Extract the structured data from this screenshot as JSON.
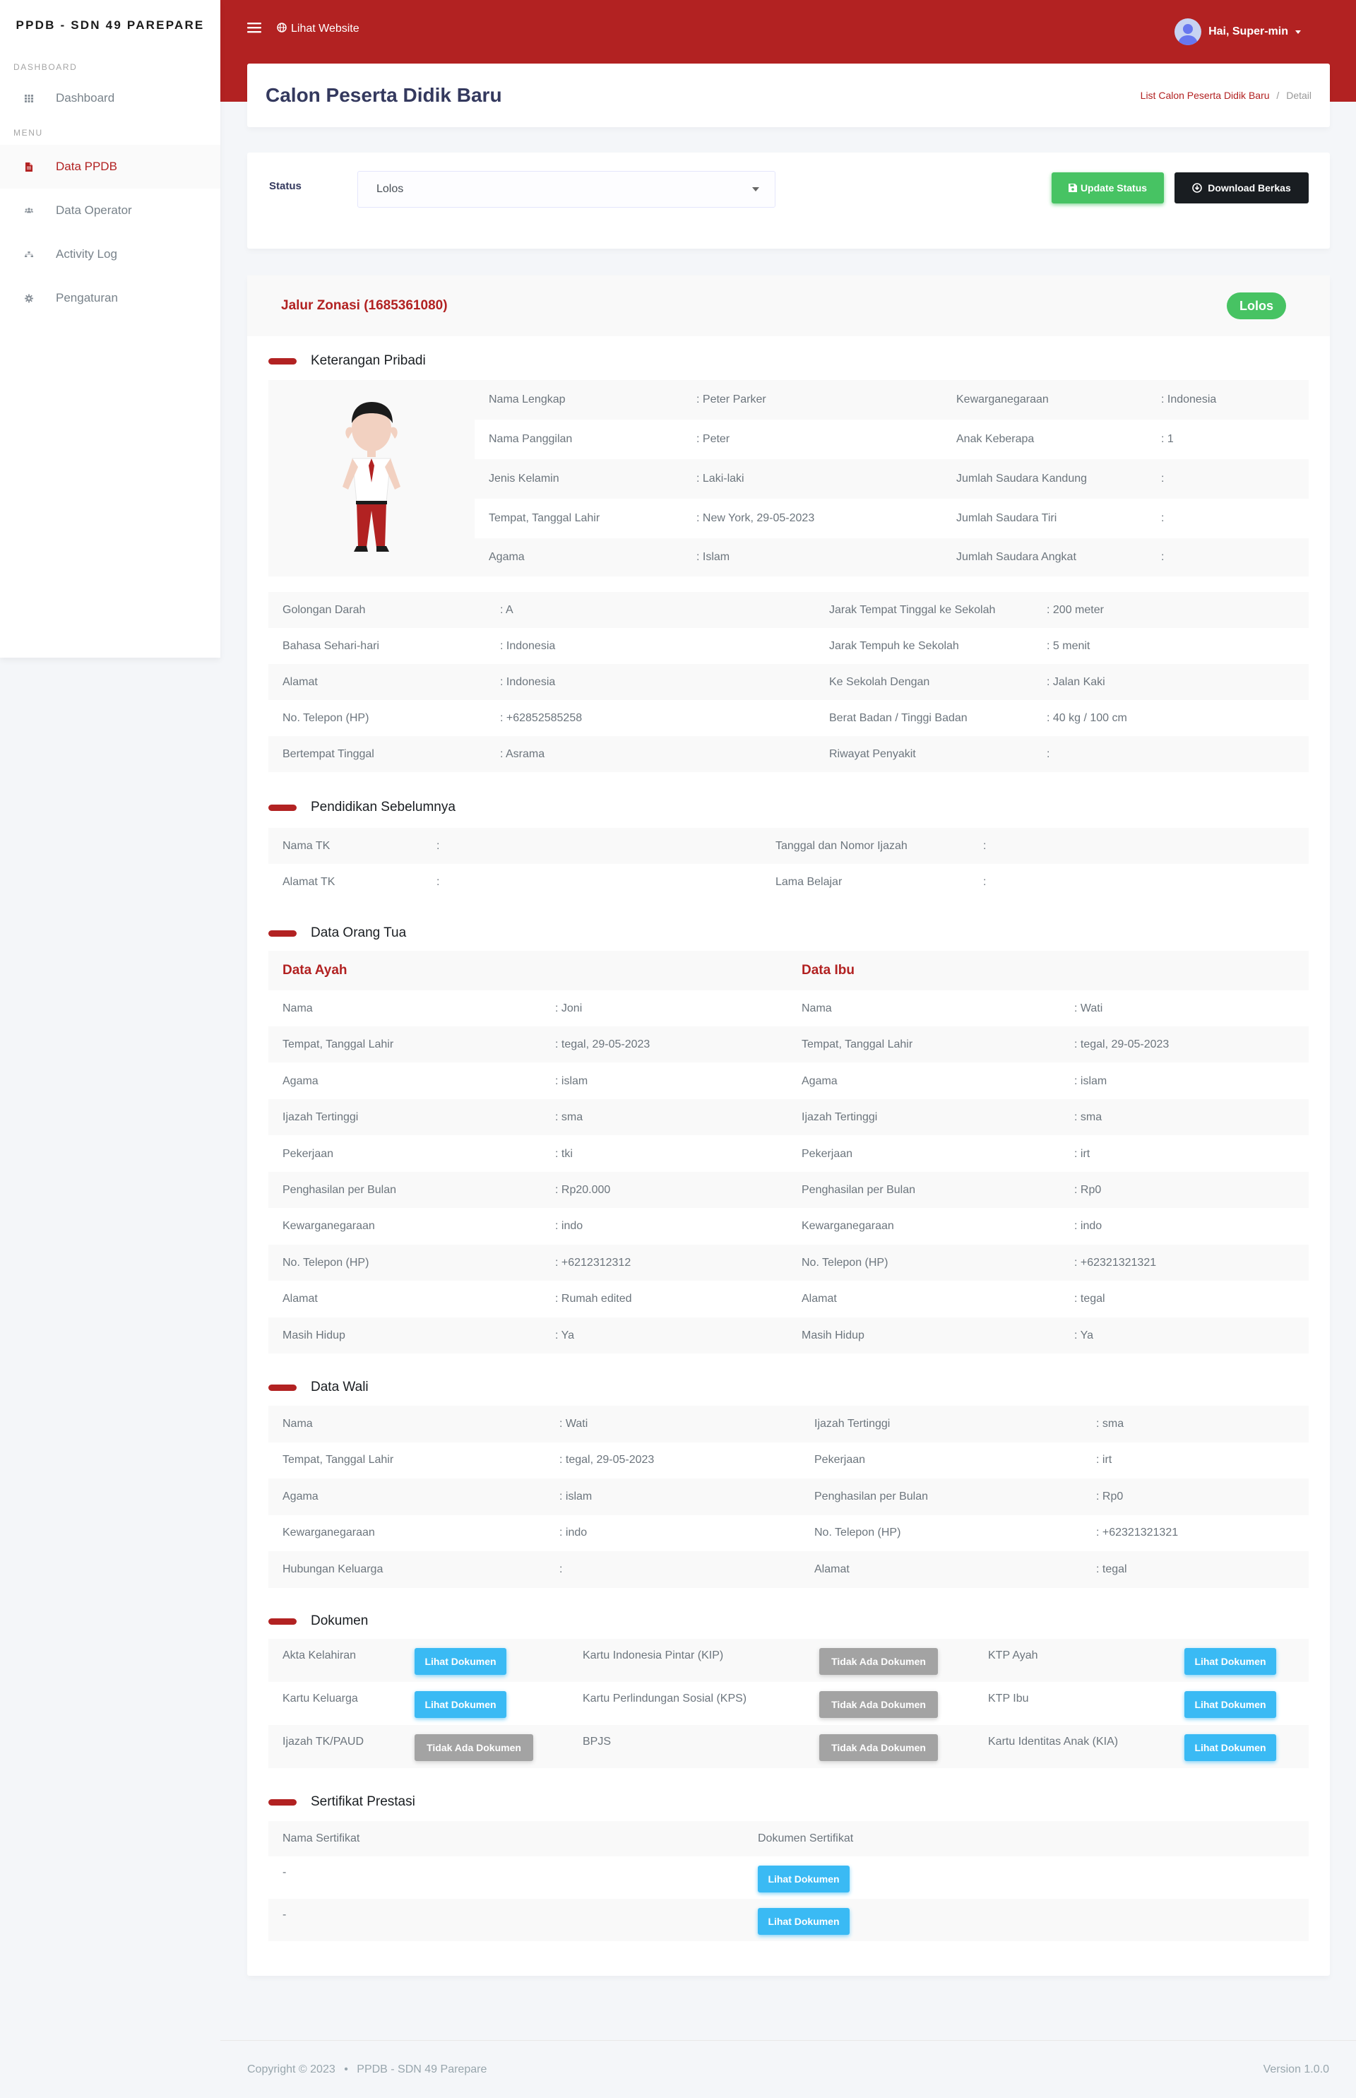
{
  "app": {
    "brand": "PPDB - SDN 49 PAREPARE"
  },
  "sidebar": {
    "header_dashboard": "DASHBOARD",
    "header_menu": "MENU",
    "items": [
      {
        "label": "Dashboard",
        "icon": "grid-icon"
      },
      {
        "label": "Data PPDB",
        "icon": "file-icon",
        "active": true
      },
      {
        "label": "Data Operator",
        "icon": "users-icon"
      },
      {
        "label": "Activity Log",
        "icon": "sitemap-icon"
      },
      {
        "label": "Pengaturan",
        "icon": "gear-icon"
      }
    ]
  },
  "navbar": {
    "visit": "Lihat Website",
    "user": "Hai, Super-min"
  },
  "page": {
    "title": "Calon Peserta Didik Baru",
    "crumb1": "List Calon Peserta Didik Baru",
    "crumb2": "Detail"
  },
  "status": {
    "label": "Status",
    "value": "Lolos",
    "update": "Update Status",
    "download": "Download Berkas"
  },
  "detail": {
    "jalur": "Jalur Zonasi (1685361080)",
    "badge": "Lolos"
  },
  "sections": {
    "pribadi": "Keterangan Pribadi",
    "pendidikan": "Pendidikan Sebelumnya",
    "ortu": "Data Orang Tua",
    "wali": "Data Wali",
    "dokumen": "Dokumen",
    "sertifikat": "Sertifikat Prestasi"
  },
  "pribadi_top": [
    [
      "Nama Lengkap",
      ": Peter Parker",
      "Kewarganegaraan",
      ": Indonesia"
    ],
    [
      "Nama Panggilan",
      ": Peter",
      "Anak Keberapa",
      ": 1"
    ],
    [
      "Jenis Kelamin",
      ": Laki-laki",
      "Jumlah Saudara Kandung",
      ":"
    ],
    [
      "Tempat, Tanggal Lahir",
      ": New York, 29-05-2023",
      "Jumlah Saudara Tiri",
      ":"
    ],
    [
      "Agama",
      ": Islam",
      "Jumlah Saudara Angkat",
      ":"
    ]
  ],
  "pribadi_bottom": [
    [
      "Golongan Darah",
      ": A",
      "Jarak Tempat Tinggal ke Sekolah",
      ": 200 meter"
    ],
    [
      "Bahasa Sehari-hari",
      ": Indonesia",
      "Jarak Tempuh ke Sekolah",
      ": 5 menit"
    ],
    [
      "Alamat",
      ": Indonesia",
      "Ke Sekolah Dengan",
      ": Jalan Kaki"
    ],
    [
      "No. Telepon (HP)",
      ": +62852585258",
      "Berat Badan / Tinggi Badan",
      ": 40 kg / 100 cm"
    ],
    [
      "Bertempat Tinggal",
      ": Asrama",
      "Riwayat Penyakit",
      ":"
    ]
  ],
  "pendidikan": [
    [
      "Nama TK",
      ":",
      "Tanggal dan Nomor Ijazah",
      ":"
    ],
    [
      "Alamat TK",
      ":",
      "Lama Belajar",
      ":"
    ]
  ],
  "ortu": {
    "ayah_title": "Data Ayah",
    "ibu_title": "Data Ibu",
    "rows": [
      [
        "Nama",
        ": Joni",
        "Nama",
        ": Wati"
      ],
      [
        "Tempat, Tanggal Lahir",
        ": tegal, 29-05-2023",
        "Tempat, Tanggal Lahir",
        ": tegal, 29-05-2023"
      ],
      [
        "Agama",
        ": islam",
        "Agama",
        ": islam"
      ],
      [
        "Ijazah Tertinggi",
        ": sma",
        "Ijazah Tertinggi",
        ": sma"
      ],
      [
        "Pekerjaan",
        ": tki",
        "Pekerjaan",
        ": irt"
      ],
      [
        "Penghasilan per Bulan",
        ": Rp20.000",
        "Penghasilan per Bulan",
        ": Rp0"
      ],
      [
        "Kewarganegaraan",
        ": indo",
        "Kewarganegaraan",
        ": indo"
      ],
      [
        "No. Telepon (HP)",
        ": +6212312312",
        "No. Telepon (HP)",
        ": +62321321321"
      ],
      [
        "Alamat",
        ": Rumah edited",
        "Alamat",
        ": tegal"
      ],
      [
        "Masih Hidup",
        ": Ya",
        "Masih Hidup",
        ": Ya"
      ]
    ]
  },
  "wali": [
    [
      "Nama",
      ": Wati",
      "Ijazah Tertinggi",
      ": sma"
    ],
    [
      "Tempat, Tanggal Lahir",
      ": tegal, 29-05-2023",
      "Pekerjaan",
      ": irt"
    ],
    [
      "Agama",
      ": islam",
      "Penghasilan per Bulan",
      ": Rp0"
    ],
    [
      "Kewarganegaraan",
      ": indo",
      "No. Telepon (HP)",
      ": +62321321321"
    ],
    [
      "Hubungan Keluarga",
      ":",
      "Alamat",
      ": tegal"
    ]
  ],
  "dokumen": [
    [
      {
        "label": "Akta Kelahiran",
        "btn": "Lihat Dokumen",
        "ok": true
      },
      {
        "label": "Kartu Indonesia Pintar (KIP)",
        "btn": "Tidak Ada Dokumen",
        "ok": false
      },
      {
        "label": "KTP Ayah",
        "btn": "Lihat Dokumen",
        "ok": true
      }
    ],
    [
      {
        "label": "Kartu Keluarga",
        "btn": "Lihat Dokumen",
        "ok": true
      },
      {
        "label": "Kartu Perlindungan Sosial (KPS)",
        "btn": "Tidak Ada Dokumen",
        "ok": false
      },
      {
        "label": "KTP Ibu",
        "btn": "Lihat Dokumen",
        "ok": true
      }
    ],
    [
      {
        "label": "Ijazah TK/PAUD",
        "btn": "Tidak Ada Dokumen",
        "ok": false
      },
      {
        "label": "BPJS",
        "btn": "Tidak Ada Dokumen",
        "ok": false
      },
      {
        "label": "Kartu Identitas Anak (KIA)",
        "btn": "Lihat Dokumen",
        "ok": true
      }
    ]
  ],
  "sertifikat": {
    "col1": "Nama Sertifikat",
    "col2": "Dokumen Sertifikat",
    "rows": [
      {
        "nama": "-",
        "btn": "Lihat Dokumen"
      },
      {
        "nama": "-",
        "btn": "Lihat Dokumen"
      }
    ]
  },
  "footer": {
    "copyright": "Copyright © 2023",
    "dot": "•",
    "app": "PPDB - SDN 49 Parepare",
    "version": "Version 1.0.0"
  },
  "colors": {
    "brand": "#b22222",
    "success": "#47c363",
    "info": "#3abaf4",
    "dark": "#191d21",
    "muted": "#a3a3a3"
  }
}
